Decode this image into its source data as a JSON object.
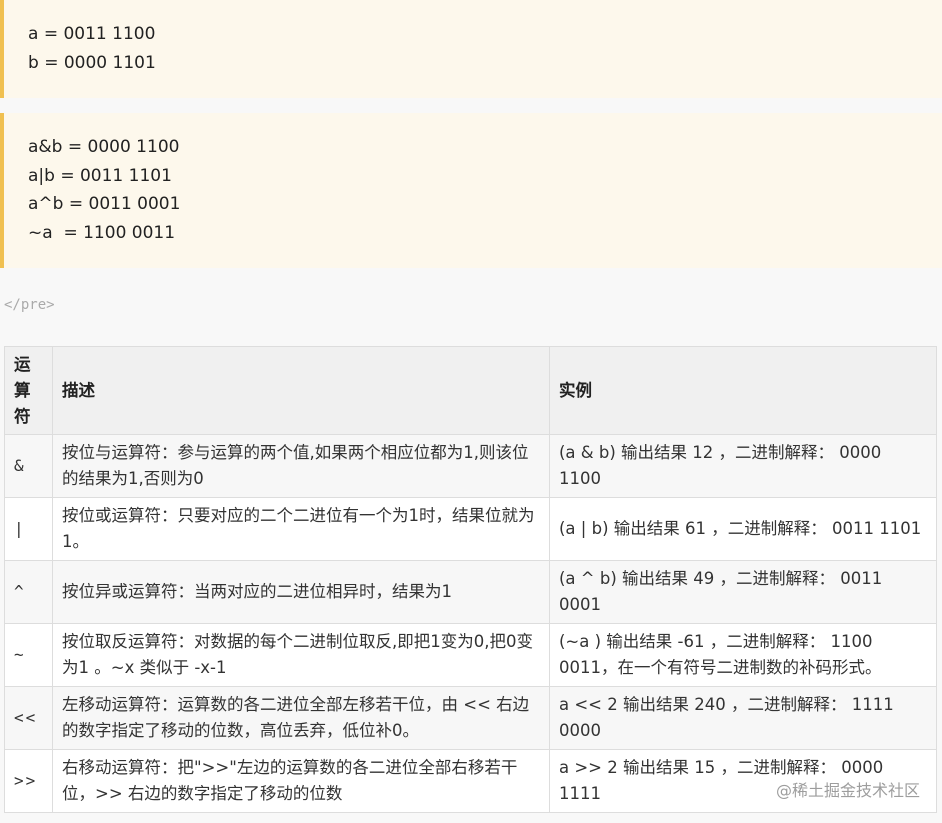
{
  "code_block_1": {
    "lines": [
      "a = 0011 1100",
      "b = 0000 1101"
    ]
  },
  "code_block_2": {
    "lines": [
      "a&b = 0000 1100",
      "a|b = 0011 1101",
      "a^b = 0011 0001",
      "~a  = 1100 0011"
    ]
  },
  "pre_close_tag": "</pre>",
  "table": {
    "headers": {
      "symbol": "运\n算\n符",
      "desc": "描述",
      "example": "实例"
    },
    "rows": [
      {
        "symbol": "&",
        "desc": "按位与运算符：参与运算的两个值,如果两个相应位都为1,则该位的结果为1,否则为0",
        "example": "(a & b) 输出结果 12 ，二进制解释： 0000 1100"
      },
      {
        "symbol": "|",
        "desc": "按位或运算符：只要对应的二个二进位有一个为1时，结果位就为1。",
        "example": "(a | b) 输出结果 61 ，二进制解释： 0011 1101"
      },
      {
        "symbol": "^",
        "desc": "按位异或运算符：当两对应的二进位相异时，结果为1",
        "example": "(a ^ b) 输出结果 49 ，二进制解释： 0011 0001"
      },
      {
        "symbol": "~",
        "desc": "按位取反运算符：对数据的每个二进制位取反,即把1变为0,把0变为1 。~x 类似于 -x-1",
        "example": "(~a ) 输出结果 -61 ，二进制解释： 1100 0011，在一个有符号二进制数的补码形式。"
      },
      {
        "symbol": "<<",
        "desc": "左移动运算符：运算数的各二进位全部左移若干位，由 << 右边的数字指定了移动的位数，高位丢弃，低位补0。",
        "example": "a << 2 输出结果 240 ，二进制解释： 1111 0000"
      },
      {
        "symbol": ">>",
        "desc": "右移动运算符：把\">>\"左边的运算数的各二进位全部右移若干位，>> 右边的数字指定了移动的位数",
        "example": "a >> 2 输出结果 15 ，二进制解释： 0000 1111"
      }
    ]
  },
  "watermark": "@稀土掘金技术社区"
}
